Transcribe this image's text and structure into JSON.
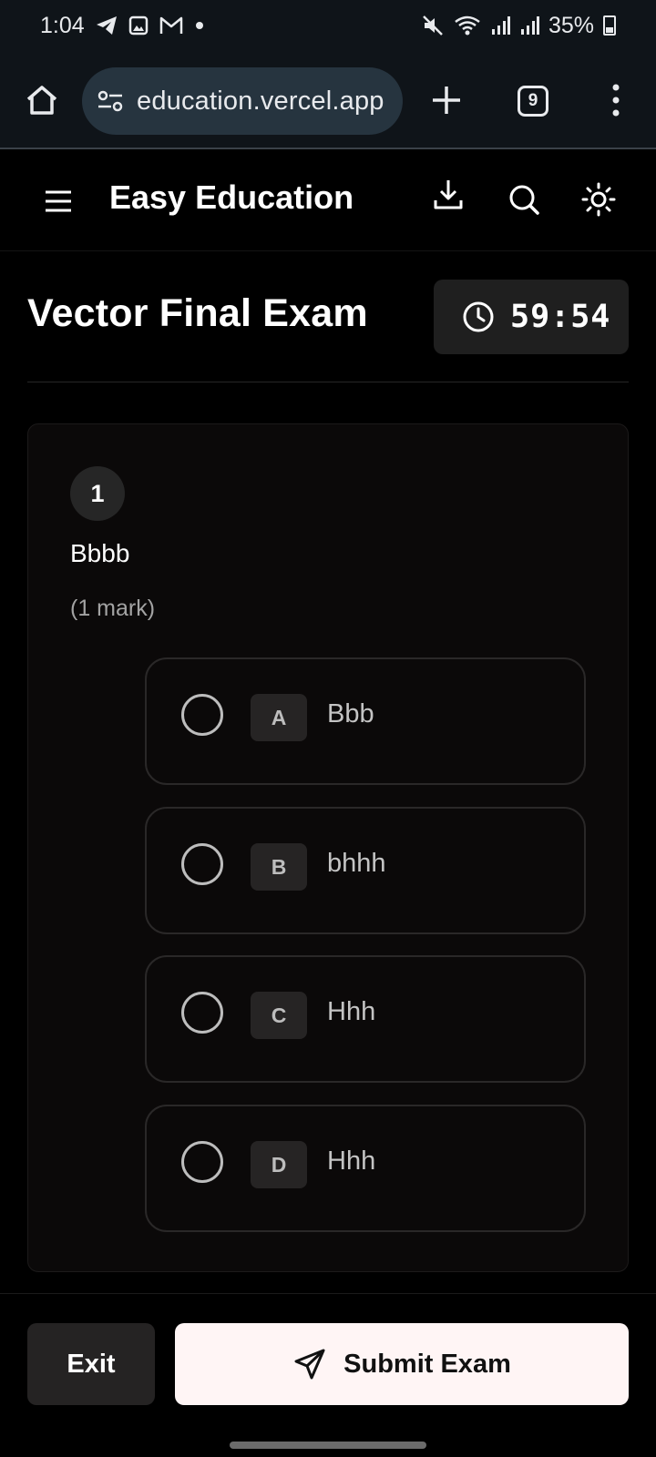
{
  "status_bar": {
    "time": "1:04",
    "battery": "35%"
  },
  "browser": {
    "url": "education.vercel.app",
    "tab_count": "9"
  },
  "app": {
    "title": "Easy Education"
  },
  "exam": {
    "title": "Vector Final Exam",
    "timer": "59:54"
  },
  "question": {
    "number": "1",
    "text": "Bbbb",
    "marks": "(1 mark)",
    "options": [
      {
        "letter": "A",
        "text": "Bbb"
      },
      {
        "letter": "B",
        "text": "bhhh"
      },
      {
        "letter": "C",
        "text": "Hhh"
      },
      {
        "letter": "D",
        "text": "Hhh"
      }
    ]
  },
  "footer": {
    "exit_label": "Exit",
    "submit_label": "Submit Exam"
  }
}
